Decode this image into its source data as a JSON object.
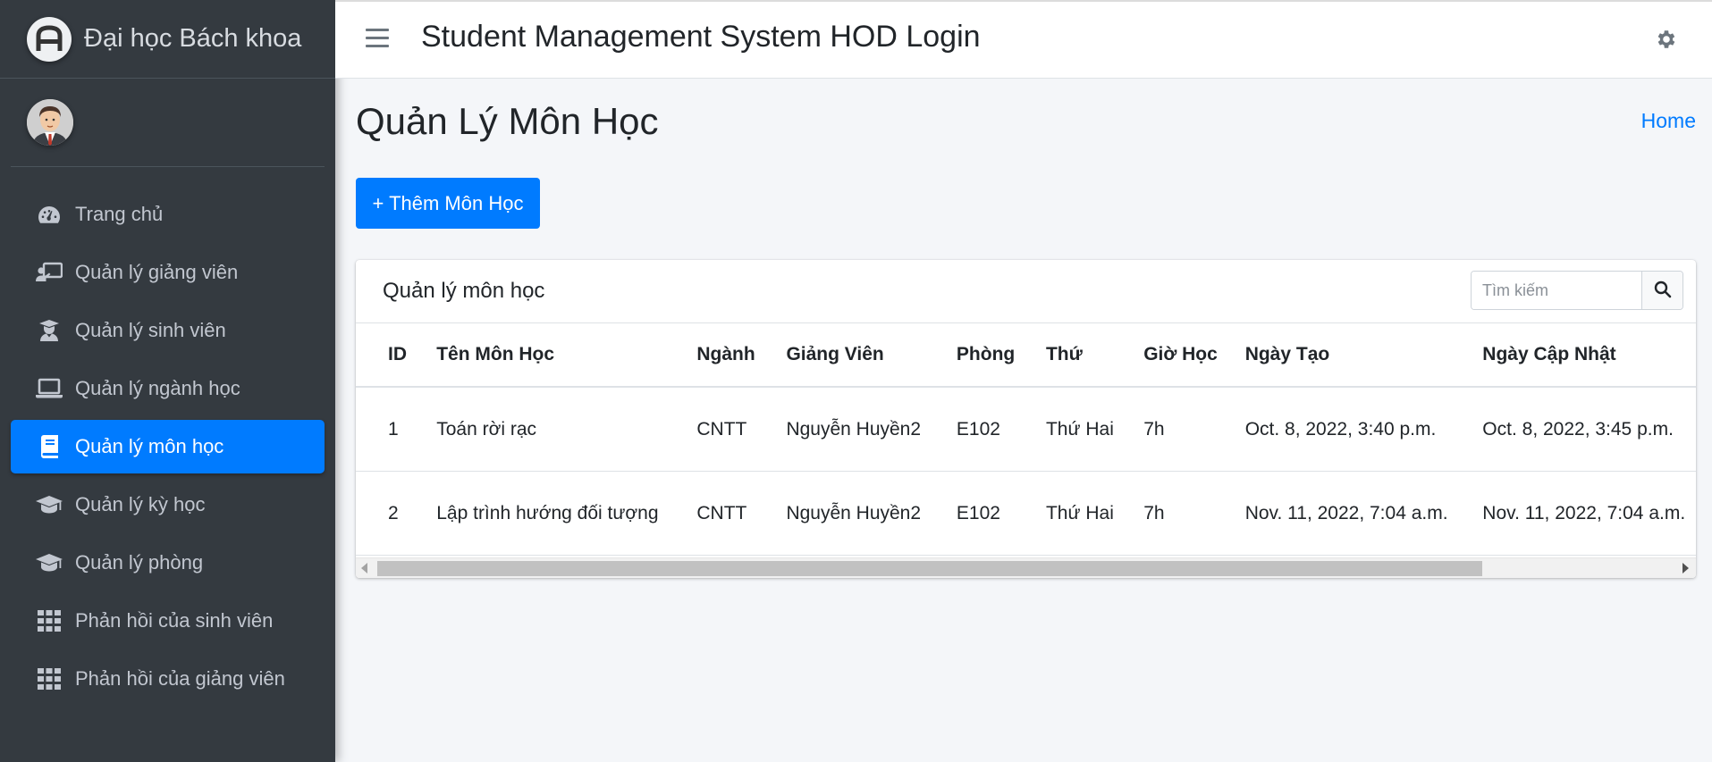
{
  "sidebar": {
    "brand": "Đại học Bách khoa",
    "active_color": "#007bff",
    "items": [
      {
        "label": "Trang chủ",
        "icon": "tachometer-icon"
      },
      {
        "label": "Quản lý giảng viên",
        "icon": "chalkboard-teacher-icon"
      },
      {
        "label": "Quản lý sinh viên",
        "icon": "user-graduate-icon"
      },
      {
        "label": "Quản lý ngành học",
        "icon": "laptop-icon"
      },
      {
        "label": "Quản lý môn học",
        "icon": "book-icon",
        "active": true
      },
      {
        "label": "Quản lý kỳ học",
        "icon": "graduation-cap-icon"
      },
      {
        "label": "Quản lý phòng",
        "icon": "graduation-cap-icon"
      },
      {
        "label": "Phản hồi của sinh viên",
        "icon": "grid-icon"
      },
      {
        "label": "Phản hồi của giảng viên",
        "icon": "grid-icon"
      }
    ]
  },
  "header": {
    "title": "Student Management System HOD Login"
  },
  "page": {
    "title": "Quản Lý Môn Học",
    "breadcrumb_home": "Home",
    "add_button": "+ Thêm Môn Học"
  },
  "card": {
    "title": "Quản lý môn học",
    "search_placeholder": "Tìm kiếm"
  },
  "table": {
    "columns": [
      "ID",
      "Tên Môn Học",
      "Ngành",
      "Giảng Viên",
      "Phòng",
      "Thứ",
      "Giờ Học",
      "Ngày Tạo",
      "Ngày Cập Nhật"
    ],
    "rows": [
      [
        "1",
        "Toán rời rạc",
        "CNTT",
        "Nguyễn Huyền2",
        "E102",
        "Thứ Hai",
        "7h",
        "Oct. 8, 2022, 3:40 p.m.",
        "Oct. 8, 2022, 3:45 p.m."
      ],
      [
        "2",
        "Lập trình hướng đối tượng",
        "CNTT",
        "Nguyễn Huyền2",
        "E102",
        "Thứ Hai",
        "7h",
        "Nov. 11, 2022, 7:04 a.m.",
        "Nov. 11, 2022, 7:04 a.m."
      ]
    ]
  }
}
